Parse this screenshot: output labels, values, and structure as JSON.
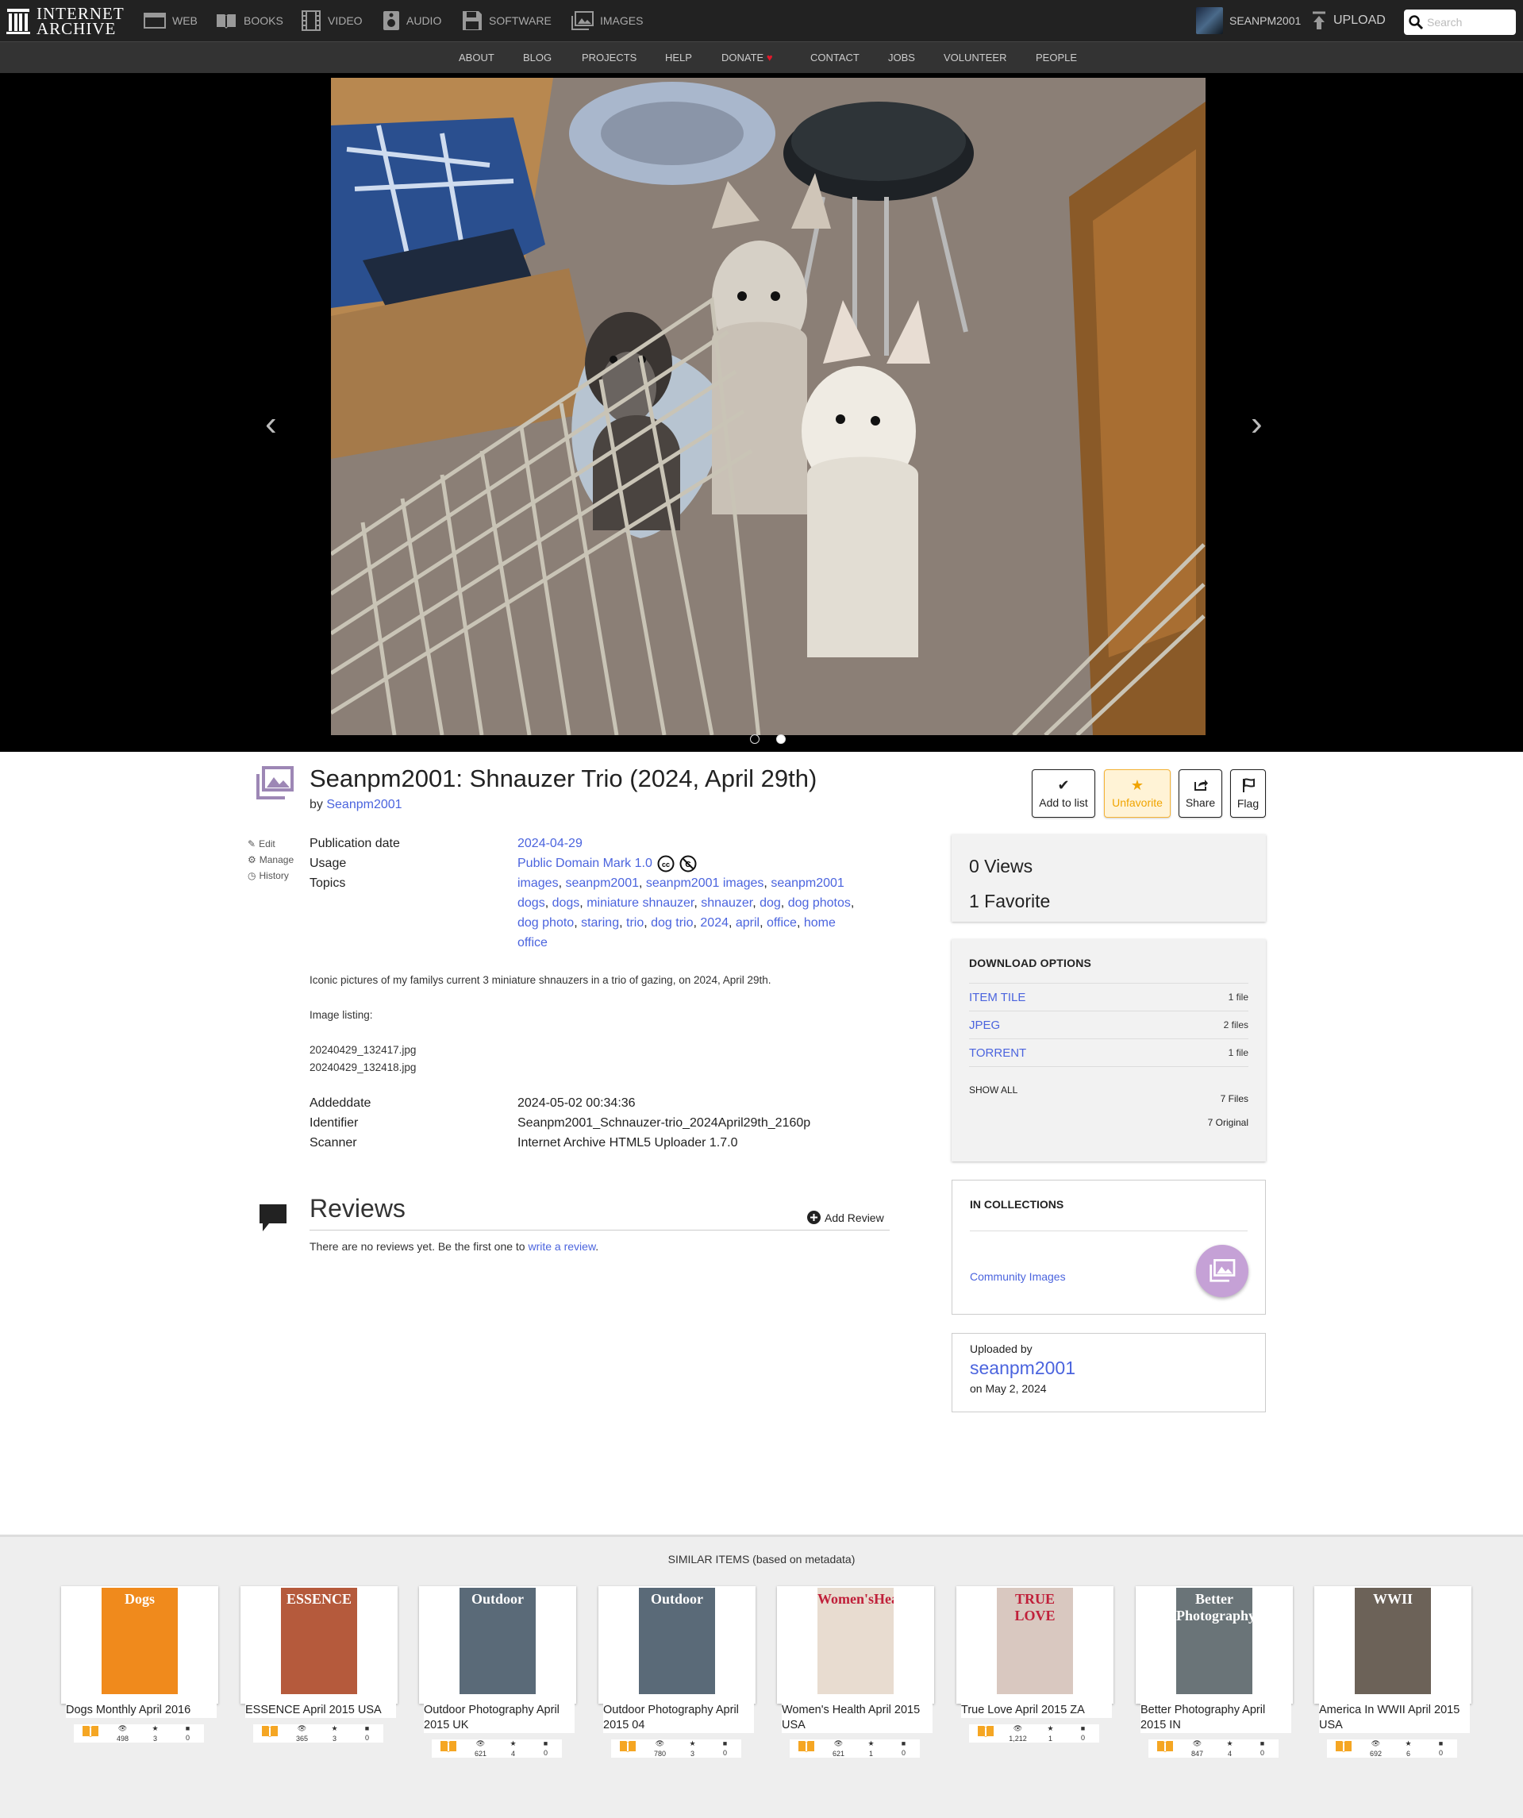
{
  "topnav": {
    "logo": [
      "INTERNET",
      "ARCHIVE"
    ],
    "media": [
      {
        "icon": "web-icon",
        "label": "WEB"
      },
      {
        "icon": "books-icon",
        "label": "BOOKS"
      },
      {
        "icon": "video-icon",
        "label": "VIDEO"
      },
      {
        "icon": "audio-icon",
        "label": "AUDIO"
      },
      {
        "icon": "software-icon",
        "label": "SOFTWARE"
      },
      {
        "icon": "images-icon",
        "label": "IMAGES"
      }
    ],
    "username": "SEANPM2001",
    "upload": "UPLOAD",
    "search_placeholder": "Search"
  },
  "subnav": [
    "ABOUT",
    "BLOG",
    "PROJECTS",
    "HELP",
    "DONATE",
    "CONTACT",
    "JOBS",
    "VOLUNTEER",
    "PEOPLE"
  ],
  "carousel": {
    "total": 2,
    "active": 2
  },
  "item": {
    "title": "Seanpm2001: Shnauzer Trio (2024, April 29th)",
    "by": "by",
    "author": "Seanpm2001",
    "actions": {
      "add_to_list": "Add to list",
      "unfavorite": "Unfavorite",
      "share": "Share",
      "flag": "Flag"
    },
    "edit_links": [
      "Edit",
      "Manage",
      "History"
    ],
    "meta": {
      "publication_date_label": "Publication date",
      "publication_date": "2024-04-29",
      "usage_label": "Usage",
      "usage": "Public Domain Mark 1.0",
      "topics_label": "Topics",
      "topics": [
        "images",
        "seanpm2001",
        "seanpm2001 images",
        "seanpm2001 dogs",
        "dogs",
        "miniature shnauzer",
        "shnauzer",
        "dog",
        "dog photos",
        "dog photo",
        "staring",
        "trio",
        "dog trio",
        "2024",
        "april",
        "office",
        "home office"
      ]
    },
    "description": {
      "line1": "Iconic pictures of my familys current 3 miniature shnauzers in a trio of gazing, on 2024, April 29th.",
      "listing_label": "Image listing:",
      "files": [
        "20240429_132417.jpg",
        "20240429_132418.jpg"
      ]
    },
    "extra": {
      "addeddate_label": "Addeddate",
      "addeddate": "2024-05-02 00:34:36",
      "identifier_label": "Identifier",
      "identifier": "Seanpm2001_Schnauzer-trio_2024April29th_2160p",
      "scanner_label": "Scanner",
      "scanner": "Internet Archive HTML5 Uploader 1.7.0"
    }
  },
  "reviews": {
    "title": "Reviews",
    "add": "Add Review",
    "empty_prefix": "There are no reviews yet. Be the first one to",
    "empty_link": "write a review",
    "empty_suffix": "."
  },
  "stats": {
    "views": "0 Views",
    "favorites": "1 Favorite"
  },
  "download": {
    "title": "DOWNLOAD OPTIONS",
    "rows": [
      {
        "label": "ITEM TILE",
        "count": "1 file"
      },
      {
        "label": "JPEG",
        "count": "2 files"
      },
      {
        "label": "TORRENT",
        "count": "1 file"
      }
    ],
    "show_all": "SHOW ALL",
    "files": "7 Files",
    "original": "7 Original"
  },
  "collections": {
    "title": "IN COLLECTIONS",
    "link": "Community Images"
  },
  "uploaded": {
    "label": "Uploaded by",
    "user": "seanpm2001",
    "date": "on May 2, 2024"
  },
  "similar": {
    "title": "SIMILAR ITEMS (based on metadata)",
    "items": [
      {
        "title": "Dogs Monthly April 2016",
        "cover": "Dogs",
        "views": "498",
        "favs": "3",
        "reviews": "0",
        "color": "#f08a1c"
      },
      {
        "title": "ESSENCE April 2015 USA",
        "cover": "ESSENCE",
        "views": "365",
        "favs": "3",
        "reviews": "0",
        "color": "#b55a3c"
      },
      {
        "title": "Outdoor Photography April 2015 UK",
        "cover": "Outdoor",
        "views": "621",
        "favs": "4",
        "reviews": "0",
        "color": "#5a6a78"
      },
      {
        "title": "Outdoor Photography April 2015 04",
        "cover": "Outdoor",
        "views": "780",
        "favs": "3",
        "reviews": "0",
        "color": "#5a6a78"
      },
      {
        "title": "Women's Health April 2015 USA",
        "cover": "Women'sHealth",
        "views": "621",
        "favs": "1",
        "reviews": "0",
        "color": "#e8dcd0"
      },
      {
        "title": "True Love April 2015 ZA",
        "cover": "TRUE LOVE",
        "views": "1,212",
        "favs": "1",
        "reviews": "0",
        "color": "#d9c8c0"
      },
      {
        "title": "Better Photography April 2015 IN",
        "cover": "Better Photography",
        "views": "847",
        "favs": "4",
        "reviews": "0",
        "color": "#6a7478"
      },
      {
        "title": "America In WWII April 2015 USA",
        "cover": "WWII",
        "views": "692",
        "favs": "6",
        "reviews": "0",
        "color": "#6c6258"
      }
    ]
  }
}
